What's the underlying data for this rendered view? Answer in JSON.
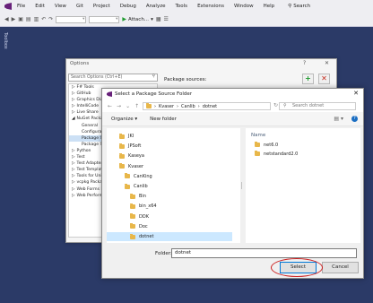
{
  "menu": {
    "items": [
      "File",
      "Edit",
      "View",
      "Git",
      "Project",
      "Debug",
      "Analyze",
      "Tools",
      "Extensions",
      "Window",
      "Help"
    ],
    "search_label": "Search"
  },
  "toolbar": {
    "attach_label": "Attach..."
  },
  "side_tab": {
    "label": "Toolbox"
  },
  "options": {
    "title": "Options",
    "search_placeholder": "Search Options (Ctrl+E)",
    "package_sources_label": "Package sources:",
    "tree_items": [
      "F# Tools",
      "GitHub",
      "Graphics Diag",
      "IntelliCode",
      "Live Share",
      "NuGet Package",
      "General",
      "Configuratio",
      "Package So",
      "Package So",
      "Python",
      "Test",
      "Test Adapter f",
      "Test Templat",
      "Tools for Unit",
      "vcpkg Packag",
      "Web Forms De",
      "Web Perform"
    ],
    "tree_prefixes": [
      "▷",
      "▷",
      "▷",
      "▷",
      "▷",
      "◢",
      "",
      "",
      "",
      "",
      "▷",
      "▷",
      "▷",
      "▷",
      "▷",
      "▷",
      "▷",
      "▷"
    ],
    "selected_index": 8
  },
  "dialog": {
    "title": "Select a Package Source Folder",
    "breadcrumb": [
      "Kvaser",
      "Canlib",
      "dotnet"
    ],
    "search_placeholder": "Search dotnet",
    "organize_label": "Organize",
    "new_folder_label": "New folder",
    "help_glyph": "?",
    "nav_folders": [
      {
        "name": "JKI",
        "indent": 0
      },
      {
        "name": "JPSoft",
        "indent": 0
      },
      {
        "name": "Kaseya",
        "indent": 0
      },
      {
        "name": "Kvaser",
        "indent": 0
      },
      {
        "name": "CanKing",
        "indent": 1
      },
      {
        "name": "Canlib",
        "indent": 1
      },
      {
        "name": "Bin",
        "indent": 2
      },
      {
        "name": "bin_x64",
        "indent": 2
      },
      {
        "name": "DDK",
        "indent": 2
      },
      {
        "name": "Doc",
        "indent": 2
      },
      {
        "name": "dotnet",
        "indent": 2
      }
    ],
    "nav_selected_index": 10,
    "content_header": "Name",
    "content_items": [
      "net6.0",
      "netstandard2.0"
    ],
    "folder_label": "Folder:",
    "folder_value": "dotnet",
    "select_label": "Select",
    "cancel_label": "Cancel"
  },
  "colors": {
    "background": "#2b3a67",
    "accent": "#0078d7",
    "highlight_circle": "#cc1e1e",
    "folder": "#e8b74a"
  }
}
